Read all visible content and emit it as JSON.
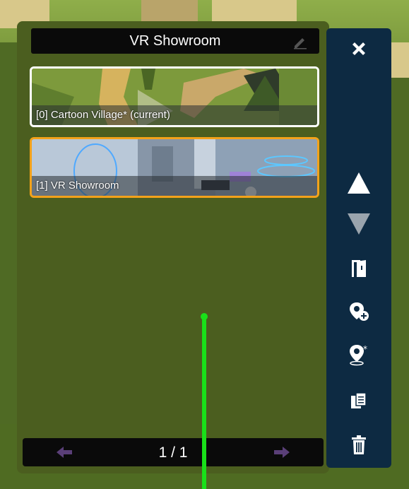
{
  "header": {
    "title": "VR Showroom"
  },
  "scenes": [
    {
      "label": "[0] Cartoon Village* (current)",
      "state": "current"
    },
    {
      "label": "[1] VR Showroom",
      "state": "selected"
    }
  ],
  "pager": {
    "label": "1 / 1"
  },
  "toolbar": {
    "icons": [
      "close-icon",
      "move-up-icon",
      "move-down-icon",
      "load-scene-icon",
      "add-location-icon",
      "edit-location-icon",
      "duplicate-icon",
      "delete-icon"
    ]
  },
  "colors": {
    "panel": "#4b5e1f",
    "toolbar": "#0d2a42",
    "selected_border": "#f3a21a",
    "current_border": "#ffffff",
    "laser": "#19e019",
    "disabled_arrow": "#5a3f78"
  }
}
